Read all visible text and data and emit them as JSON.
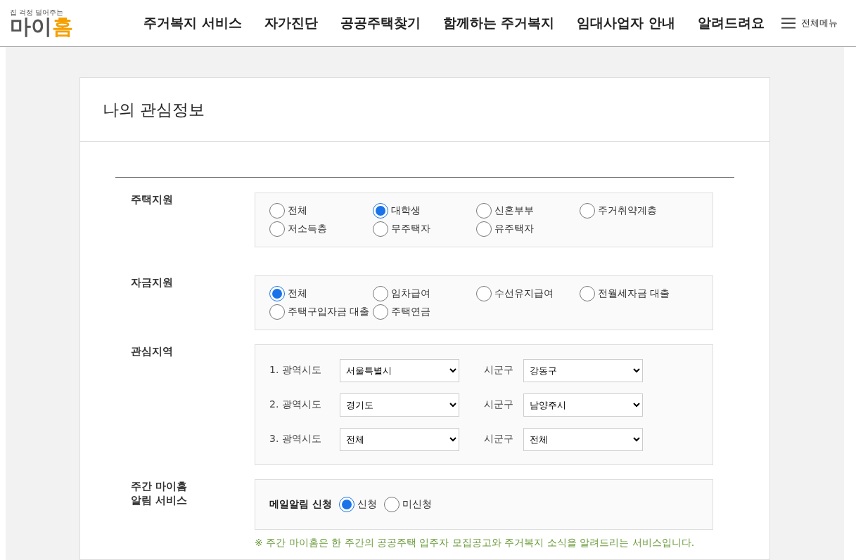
{
  "header": {
    "logo": {
      "tagline": "집 걱정 덜어주는",
      "name_main": "마이",
      "name_accent": "홈"
    },
    "nav": [
      "주거복지 서비스",
      "자가진단",
      "공공주택찾기",
      "함께하는 주거복지",
      "임대사업자 안내",
      "알려드려요"
    ],
    "menu_button": "전체메뉴"
  },
  "page_title": "나의 관심정보",
  "sections": [
    {
      "kind": "radios",
      "label": "주택지원",
      "options": [
        {
          "label": "전체",
          "selected": false
        },
        {
          "label": "대학생",
          "selected": true
        },
        {
          "label": "신혼부부",
          "selected": false
        },
        {
          "label": "주거취약계층",
          "selected": false
        },
        {
          "label": "저소득층",
          "selected": false
        },
        {
          "label": "무주택자",
          "selected": false
        },
        {
          "label": "유주택자",
          "selected": false
        }
      ]
    },
    {
      "kind": "radios",
      "label": "자금지원",
      "options": [
        {
          "label": "전체",
          "selected": true
        },
        {
          "label": "임차급여",
          "selected": false
        },
        {
          "label": "수선유지급여",
          "selected": false
        },
        {
          "label": "전월세자금 대출",
          "selected": false
        },
        {
          "label": "주택구입자금 대출",
          "selected": false
        },
        {
          "label": "주택연금",
          "selected": false
        }
      ]
    },
    {
      "kind": "regions",
      "label": "관심지역",
      "rows": [
        {
          "label": "1. 광역시도",
          "province": "서울특별시",
          "district_label": "시군구",
          "district": "강동구"
        },
        {
          "label": "2. 광역시도",
          "province": "경기도",
          "district_label": "시군구",
          "district": "남양주시"
        },
        {
          "label": "3. 광역시도",
          "province": "전체",
          "district_label": "시군구",
          "district": "전체"
        }
      ]
    },
    {
      "kind": "mail",
      "label": "주간 마이홈\n알림 서비스",
      "field_label": "메일알림 신청",
      "options": [
        {
          "label": "신청",
          "selected": true
        },
        {
          "label": "미신청",
          "selected": false
        }
      ],
      "note": "※ 주간 마이홈은 한 주간의 공공주택 입주자 모집공고와 주거복지 소식을 알려드리는 서비스입니다."
    }
  ]
}
